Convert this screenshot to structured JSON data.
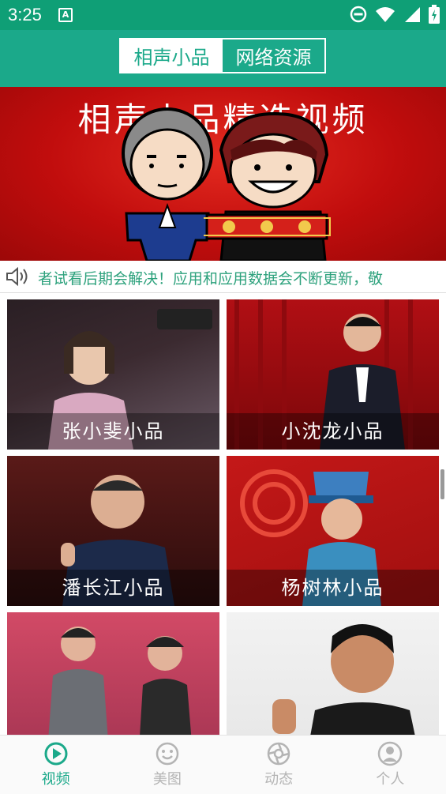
{
  "status_bar": {
    "time": "3:25",
    "notif_icon_letter": "A"
  },
  "header": {
    "tabs": [
      {
        "label": "相声小品",
        "active": true
      },
      {
        "label": "网络资源",
        "active": false
      }
    ]
  },
  "banner": {
    "title": "相声小品精选视频"
  },
  "marquee": {
    "text": "者试看后期会解决！应用和应用数据会不断更新，敬"
  },
  "videos": [
    {
      "title": "张小斐小品"
    },
    {
      "title": "小沈龙小品"
    },
    {
      "title": "潘长江小品"
    },
    {
      "title": "杨树林小品"
    },
    {
      "title": ""
    },
    {
      "title": ""
    }
  ],
  "bottom_nav": [
    {
      "label": "视频",
      "icon": "play-icon",
      "active": true
    },
    {
      "label": "美图",
      "icon": "smiley-icon",
      "active": false
    },
    {
      "label": "动态",
      "icon": "aperture-icon",
      "active": false
    },
    {
      "label": "个人",
      "icon": "person-icon",
      "active": false
    }
  ],
  "colors": {
    "primary": "#1ba98a",
    "status_bar": "#0f9f76",
    "banner_red": "#c10d0d",
    "marquee_text": "#2ea27d"
  }
}
